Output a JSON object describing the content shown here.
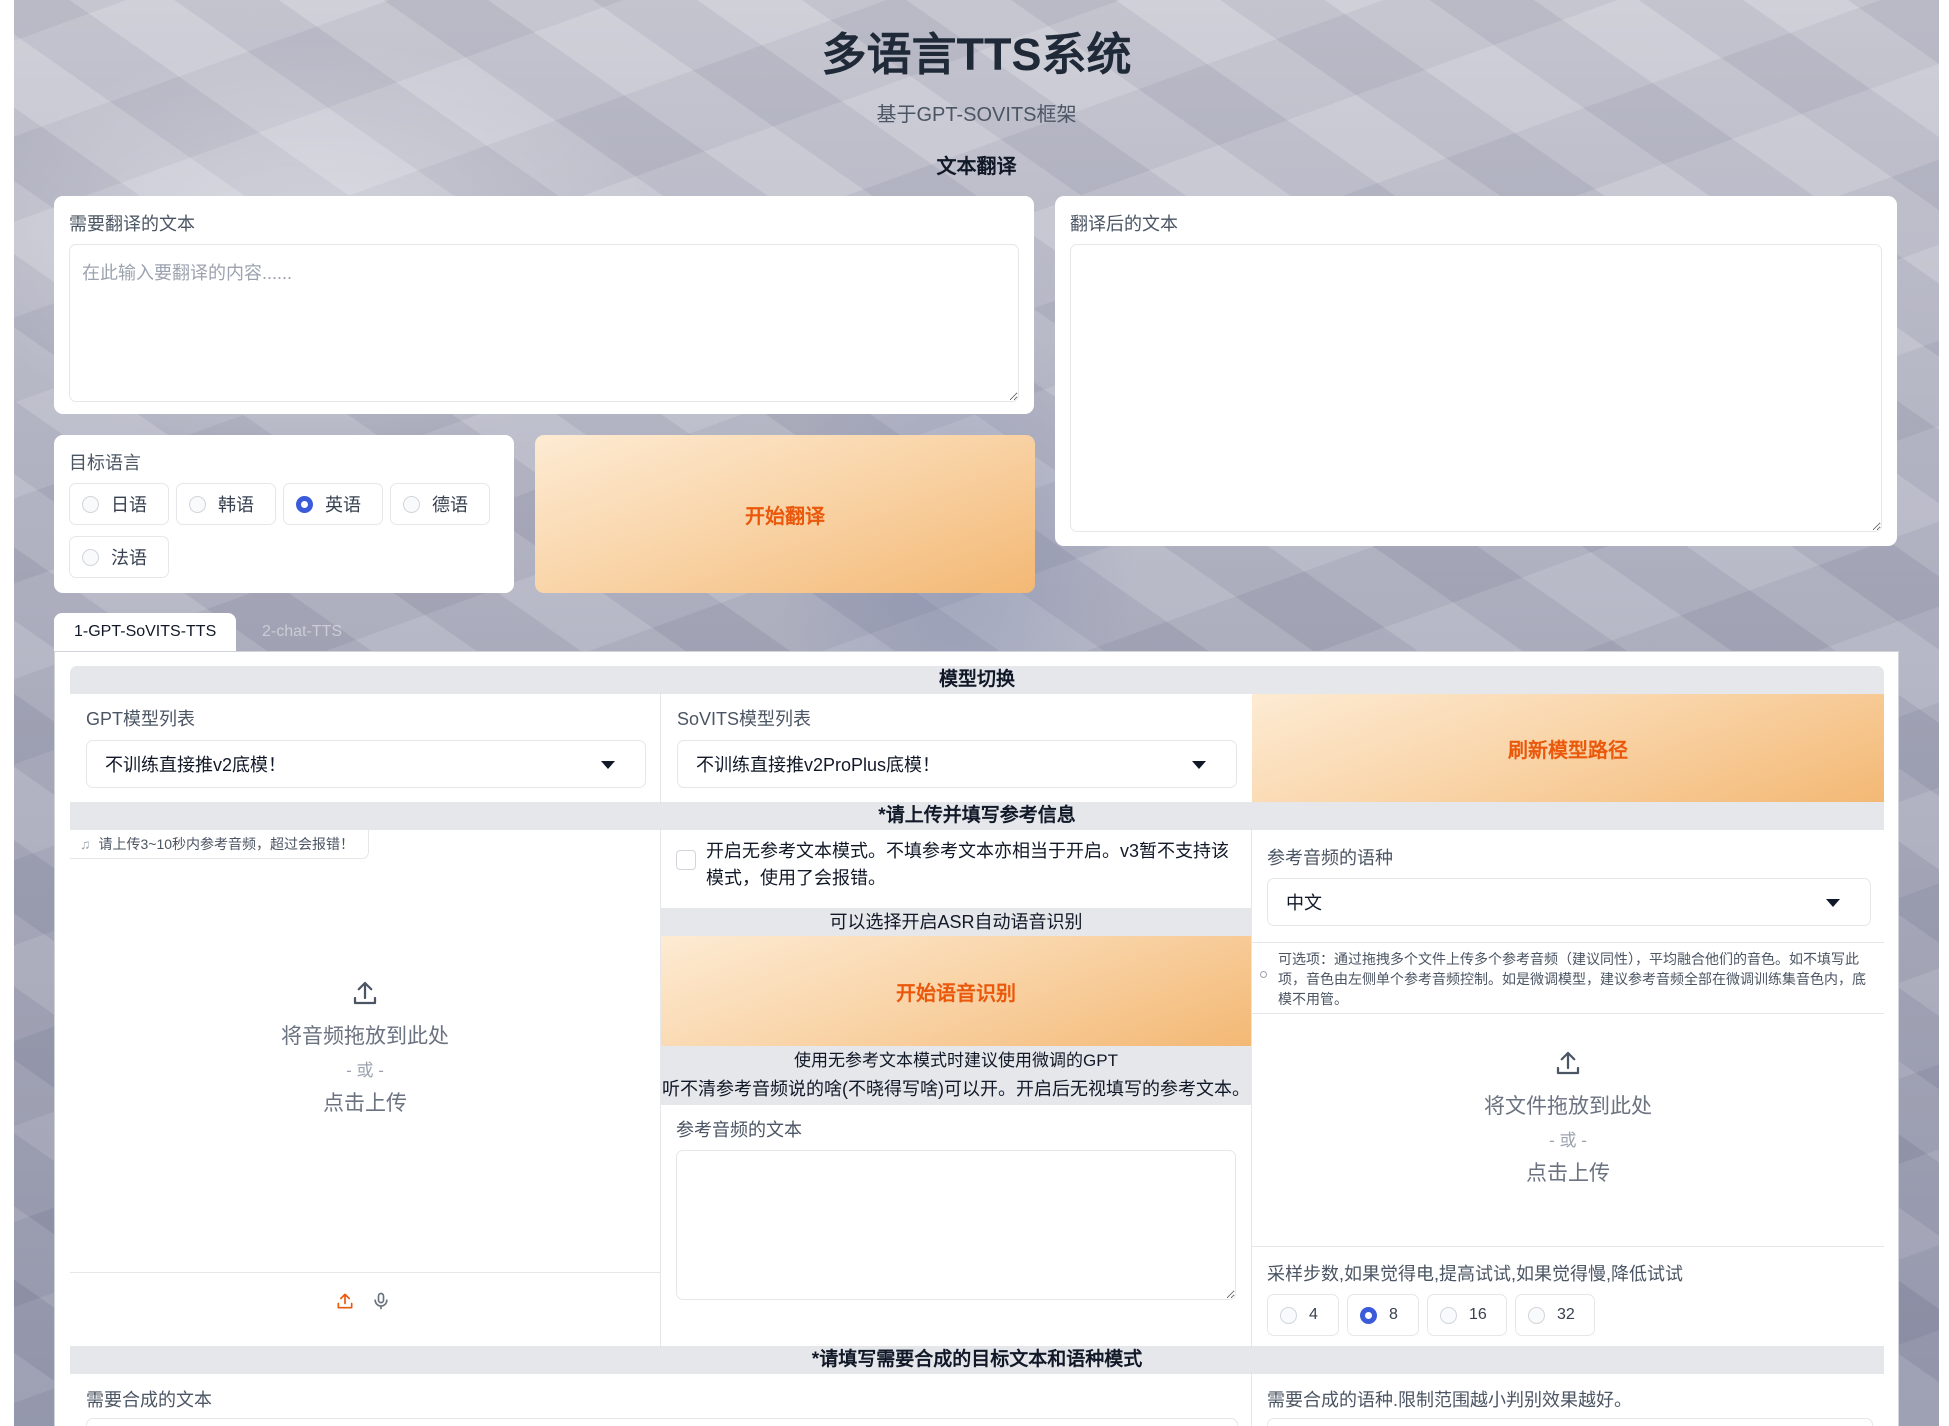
{
  "header": {
    "title": "多语言TTS系统",
    "subtitle": "基于GPT-SOVITS框架",
    "section": "文本翻译"
  },
  "translate": {
    "source_label": "需要翻译的文本",
    "source_placeholder": "在此输入要翻译的内容......",
    "result_label": "翻译后的文本",
    "target_label": "目标语言",
    "languages": [
      "日语",
      "韩语",
      "英语",
      "德语",
      "法语"
    ],
    "selected_language": "英语",
    "start_button": "开始翻译"
  },
  "tabs": [
    {
      "label": "1-GPT-SoVITS-TTS",
      "active": true
    },
    {
      "label": "2-chat-TTS",
      "active": false
    }
  ],
  "model_section": {
    "title": "模型切换",
    "gpt_label": "GPT模型列表",
    "gpt_value": "不训练直接推v2底模！",
    "sovits_label": "SoVITS模型列表",
    "sovits_value": "不训练直接推v2ProPlus底模！",
    "refresh_button": "刷新模型路径"
  },
  "reference_section": {
    "title": "*请上传并填写参考信息",
    "audio_badge": "请上传3~10秒内参考音频，超过会报错！",
    "drop_text": "将音频拖放到此处",
    "or_text": "- 或 -",
    "click_text": "点击上传",
    "no_ref_checkbox": "开启无参考文本模式。不填参考文本亦相当于开启。v3暂不支持该模式，使用了会报错。",
    "asr_hint": "可以选择开启ASR自动语音识别",
    "asr_button": "开始语音识别",
    "note_line1": "使用无参考文本模式时建议使用微调的GPT",
    "note_line2": "听不清参考音频说的啥(不晓得写啥)可以开。开启后无视填写的参考文本。",
    "ref_text_label": "参考音频的文本",
    "ref_lang_label": "参考音频的语种",
    "ref_lang_value": "中文",
    "multi_info": "可选项：通过拖拽多个文件上传多个参考音频（建议同性），平均融合他们的音色。如不填写此项，音色由左侧单个参考音频控制。如是微调模型，建议参考音频全部在微调训练集音色内，底模不用管。",
    "file_drop_text": "将文件拖放到此处",
    "file_or_text": "- 或 -",
    "file_click_text": "点击上传",
    "steps_label": "采样步数,如果觉得电,提高试试,如果觉得慢,降低试试",
    "steps": [
      "4",
      "8",
      "16",
      "32"
    ],
    "steps_selected": "8"
  },
  "synth_section": {
    "title": "*请填写需要合成的目标文本和语种模式",
    "text_label": "需要合成的文本",
    "lang_label": "需要合成的语种.限制范围越小判别效果越好。"
  },
  "colors": {
    "accent": "#ea580c",
    "radio_selected": "#3b5bdb",
    "section_bar": "#e5e7eb"
  }
}
